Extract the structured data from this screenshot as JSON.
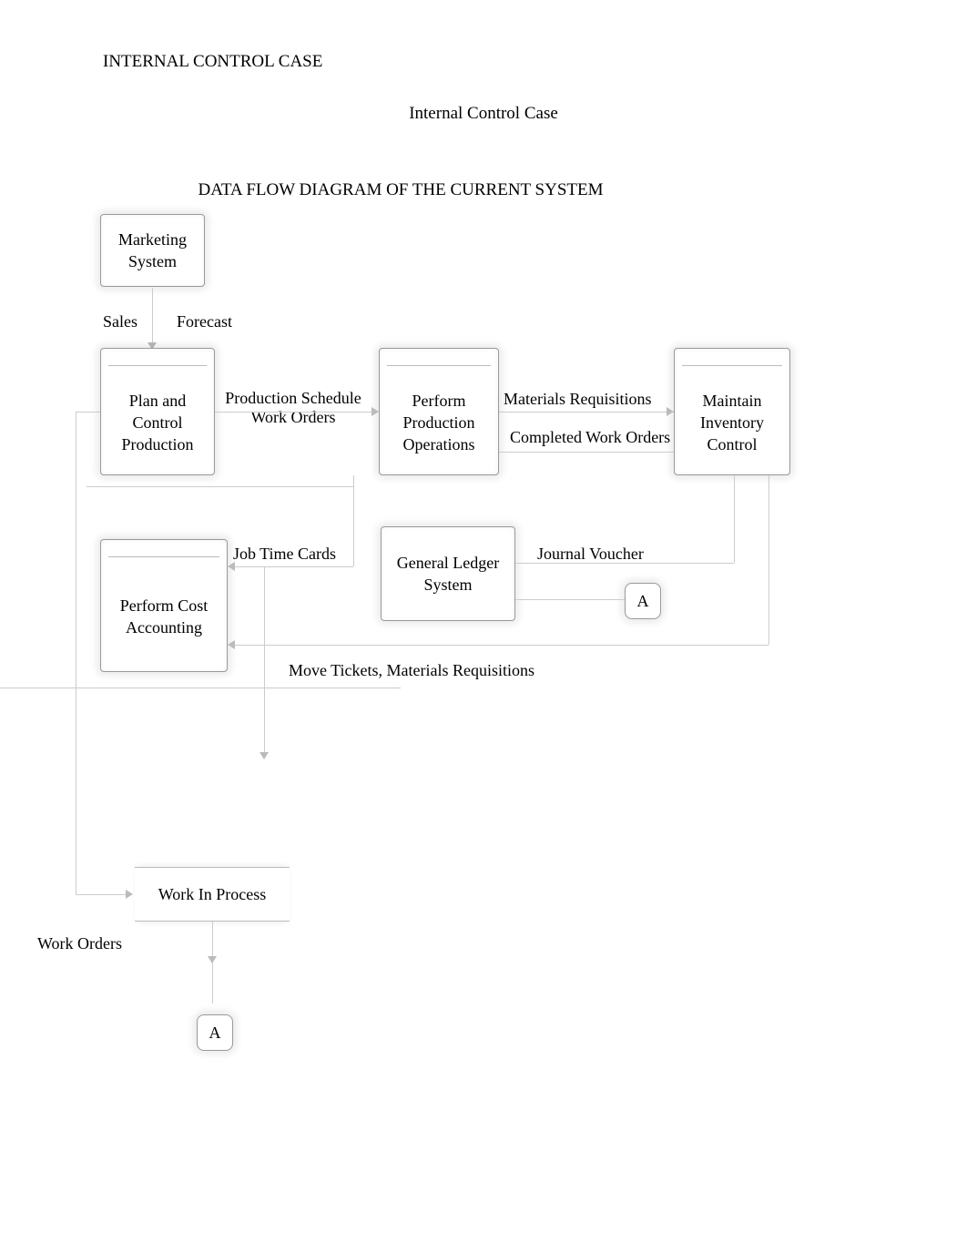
{
  "header": "INTERNAL CONTROL CASE",
  "title": "Internal Control Case",
  "section_title": "DATA FLOW DIAGRAM OF THE CURRENT SYSTEM",
  "boxes": {
    "marketing": "Marketing System",
    "plan_control": "Plan and Control Production",
    "perform_ops": "Perform Production Operations",
    "maintain_inv": "Maintain Inventory Control",
    "cost_acct": "Perform Cost Accounting",
    "gl": "General Ledger System"
  },
  "flows": {
    "sales": "Sales",
    "forecast": "Forecast",
    "prod_sched": "Production Schedule Work Orders",
    "mat_req": "Materials Requisitions",
    "completed_wo": "Completed Work Orders",
    "job_time": "Job Time Cards",
    "journal_voucher": "Journal Voucher",
    "move_tickets": "Move Tickets, Materials Requisitions",
    "work_orders": "Work Orders",
    "wip": "Work In Process"
  },
  "connector": "A"
}
